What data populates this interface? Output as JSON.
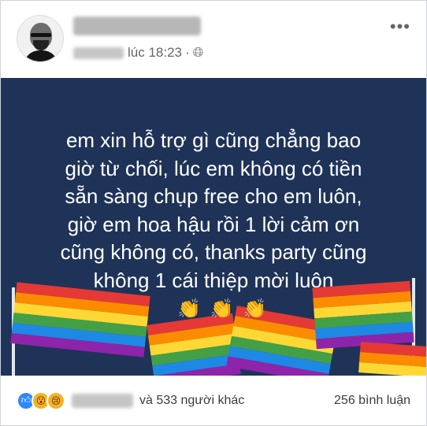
{
  "header": {
    "time": "lúc 18:23",
    "more_label": "•••",
    "privacy_icon": "globe-icon"
  },
  "post": {
    "text": "em xin hỗ trợ gì cũng chẳng bao\ngiờ từ chối,  lúc em không có tiền\nsẵn sàng chụp free cho em luôn,\ngiờ em hoa hậu rồi 1 lời cảm ơn\ncũng không có, thanks party cũng\nkhông 1 cái thiệp mời luôn",
    "background_color": "#1f3358",
    "icons": [
      "rainbow-flag-icon",
      "clapping-hands-icon"
    ]
  },
  "footer": {
    "reactions": [
      "like-icon",
      "wow-icon",
      "sad-icon"
    ],
    "others_text": "và 533 người khác",
    "comments_text": "256 bình luận"
  }
}
